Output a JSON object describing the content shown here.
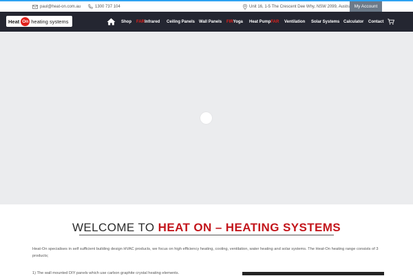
{
  "topbar": {
    "email": "paul@heat-on.com.au",
    "phone": "1300 737 104",
    "address": "Unit 16, 1-5 The Crescent Dee Why, NSW 2099, Australia",
    "account_label": "My Account",
    "icons": [
      "envelope-icon",
      "phone-icon",
      "map-pin-icon"
    ]
  },
  "logo": {
    "heat": "Heat",
    "on": "On",
    "rest": "heating systems"
  },
  "nav": {
    "items": [
      {
        "label": "Shop"
      },
      {
        "prefix": "FAR",
        "label": " Infrared"
      },
      {
        "label": "Ceiling Panels"
      },
      {
        "label": "Wall Panels"
      },
      {
        "prefix": "FIR",
        "label": " Yoga"
      },
      {
        "label": "Heat Pump ",
        "suffix": "FAR"
      },
      {
        "label": "Ventilation"
      },
      {
        "label": "Solar Systems"
      },
      {
        "label": "Calculator"
      },
      {
        "label": "Contact"
      }
    ],
    "icons": [
      "home-icon",
      "cart-icon"
    ]
  },
  "welcome": {
    "part1": "WELCOME TO ",
    "part2": "HEAT ON – HEATING SYSTEMS"
  },
  "intro": "Heat-On specialises in self sufficient building design HVAC products, we focus on high efficiency heating, cooling, ventilation, water heating and solar systems.  The Heat-On heating range consists of 3 products;",
  "list_item_1": "1) The wall mounted DIY panels which use carbon graphite crystal heating elements.",
  "colors": {
    "accent": "#2ea3f2",
    "nav_bg": "#242631",
    "brand_red": "#c3161c",
    "hero_bg": "#ebecee"
  }
}
